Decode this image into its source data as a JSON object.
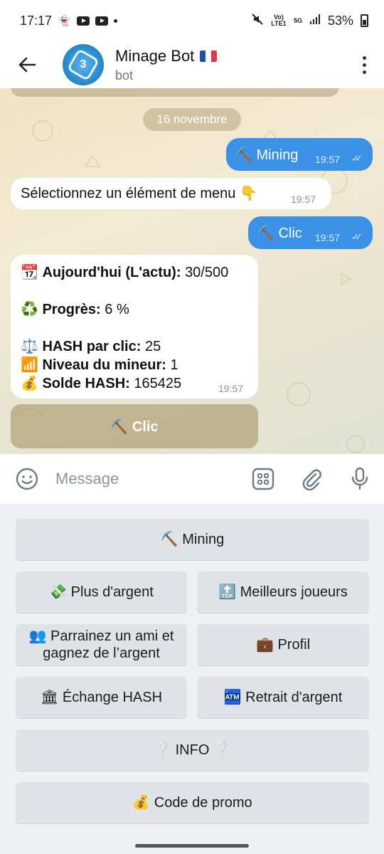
{
  "status_bar": {
    "time": "17:17",
    "network": "Vo) LTE1",
    "network_type": "5G",
    "battery": "53%"
  },
  "header": {
    "title": "Minage Bot",
    "flag": "🇫🇷",
    "subtitle": "bot",
    "avatar_number": "3"
  },
  "chat": {
    "date_separator": "16 novembre",
    "messages": [
      {
        "direction": "out",
        "text": "⛏️ Mining",
        "time": "19:57",
        "read": true
      },
      {
        "direction": "in",
        "text": "Sélectionnez un élément de menu 👇",
        "time": "19:57"
      },
      {
        "direction": "out",
        "text": "⛏️ Clic",
        "time": "19:57",
        "read": true
      }
    ],
    "info_message": {
      "lines": [
        {
          "icon": "📆",
          "label": "Aujourd'hui (L'actu):",
          "value": "30/500"
        },
        {
          "icon": "♻️",
          "label": "Progrès:",
          "value": "6 %"
        },
        {
          "icon": "⚖️",
          "label": "HASH par clic:",
          "value": "25"
        },
        {
          "icon": "📶",
          "label": "Niveau du mineur:",
          "value": "1"
        },
        {
          "icon": "💰",
          "label": "Solde HASH:",
          "value": "165425"
        }
      ],
      "time": "19:57"
    },
    "inline_button": "⛏️ Clic"
  },
  "input": {
    "placeholder": "Message"
  },
  "keyboard": {
    "buttons": [
      {
        "label": "⛏️ Mining"
      },
      {
        "label": "💸 Plus d'argent"
      },
      {
        "label": "🔝 Meilleurs joueurs"
      },
      {
        "label": "👥 Parrainez un ami et gagnez de l’argent"
      },
      {
        "label": "💼 Profil"
      },
      {
        "label": "🏛 Échange HASH"
      },
      {
        "label": "🏧 Retrait d'argent"
      },
      {
        "label": "❔ INFO ❔"
      },
      {
        "label": "💰 Code de promo"
      }
    ]
  },
  "colors": {
    "outgoing_bubble": "#3b91e6",
    "incoming_bubble": "#ffffff",
    "keyboard_button": "#dfe3e7"
  }
}
